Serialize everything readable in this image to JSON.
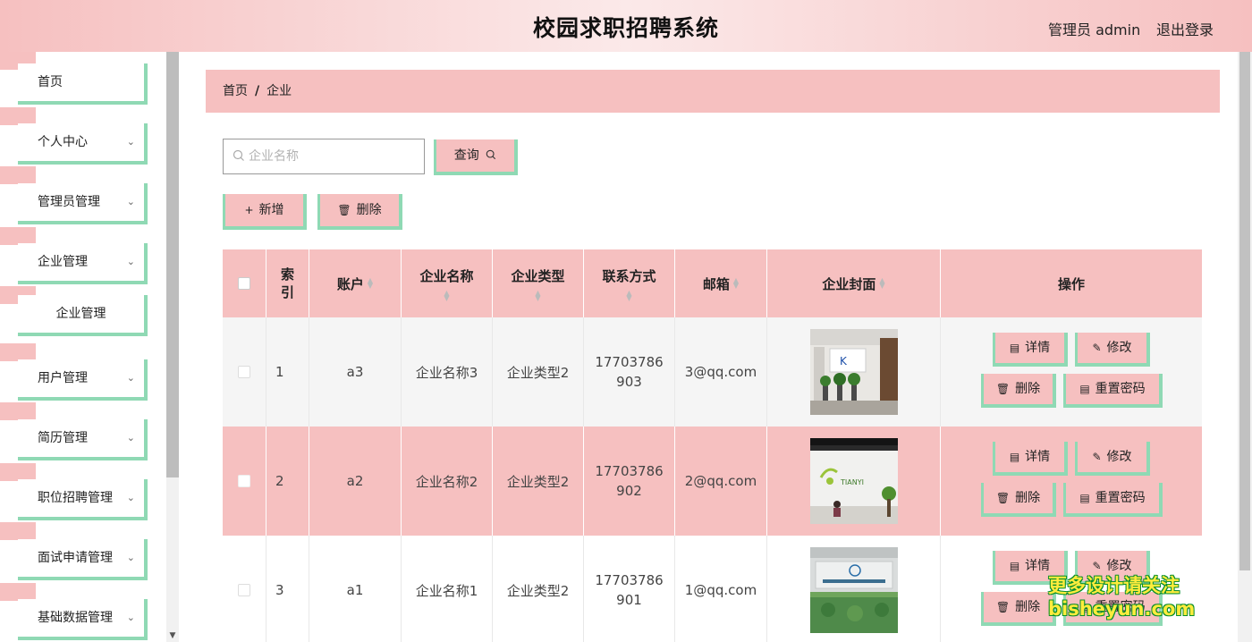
{
  "header": {
    "title": "校园求职招聘系统",
    "admin_label": "管理员 admin",
    "logout_label": "退出登录"
  },
  "sidebar": {
    "items": [
      {
        "label": "首页",
        "has_chevron": false
      },
      {
        "label": "个人中心",
        "has_chevron": true
      },
      {
        "label": "管理员管理",
        "has_chevron": true
      },
      {
        "label": "企业管理",
        "has_chevron": true
      },
      {
        "label": "企业管理",
        "has_chevron": false,
        "sub": true
      },
      {
        "label": "用户管理",
        "has_chevron": true
      },
      {
        "label": "简历管理",
        "has_chevron": true
      },
      {
        "label": "职位招聘管理",
        "has_chevron": true
      },
      {
        "label": "面试申请管理",
        "has_chevron": true
      },
      {
        "label": "基础数据管理",
        "has_chevron": true
      }
    ]
  },
  "breadcrumb": {
    "home": "首页",
    "separator": "/",
    "current": "企业"
  },
  "search": {
    "placeholder": "企业名称",
    "value": "",
    "query_label": "查询"
  },
  "toolbar": {
    "add_label": "新增",
    "delete_label": "删除"
  },
  "table": {
    "headers": {
      "index": "索引",
      "account": "账户",
      "company_name": "企业名称",
      "company_type": "企业类型",
      "contact": "联系方式",
      "email": "邮箱",
      "cover": "企业封面",
      "actions": "操作"
    },
    "rows": [
      {
        "index": "1",
        "account": "a3",
        "company_name": "企业名称3",
        "company_type": "企业类型2",
        "contact_line1": "17703786",
        "contact_line2": "903",
        "email": "3@qq.com"
      },
      {
        "index": "2",
        "account": "a2",
        "company_name": "企业名称2",
        "company_type": "企业类型2",
        "contact_line1": "17703786",
        "contact_line2": "902",
        "email": "2@qq.com"
      },
      {
        "index": "3",
        "account": "a1",
        "company_name": "企业名称1",
        "company_type": "企业类型2",
        "contact_line1": "17703786",
        "contact_line2": "901",
        "email": "1@qq.com"
      }
    ],
    "actions": {
      "detail": "详情",
      "edit": "修改",
      "delete": "删除",
      "reset_password": "重置密码"
    }
  },
  "watermark": {
    "line1": "更多设计请关注",
    "line2": "bisheyun.com"
  },
  "colors": {
    "pink": "#f6c0c0",
    "mint": "#8fd9b4",
    "row_grey": "#f5f5f5"
  }
}
